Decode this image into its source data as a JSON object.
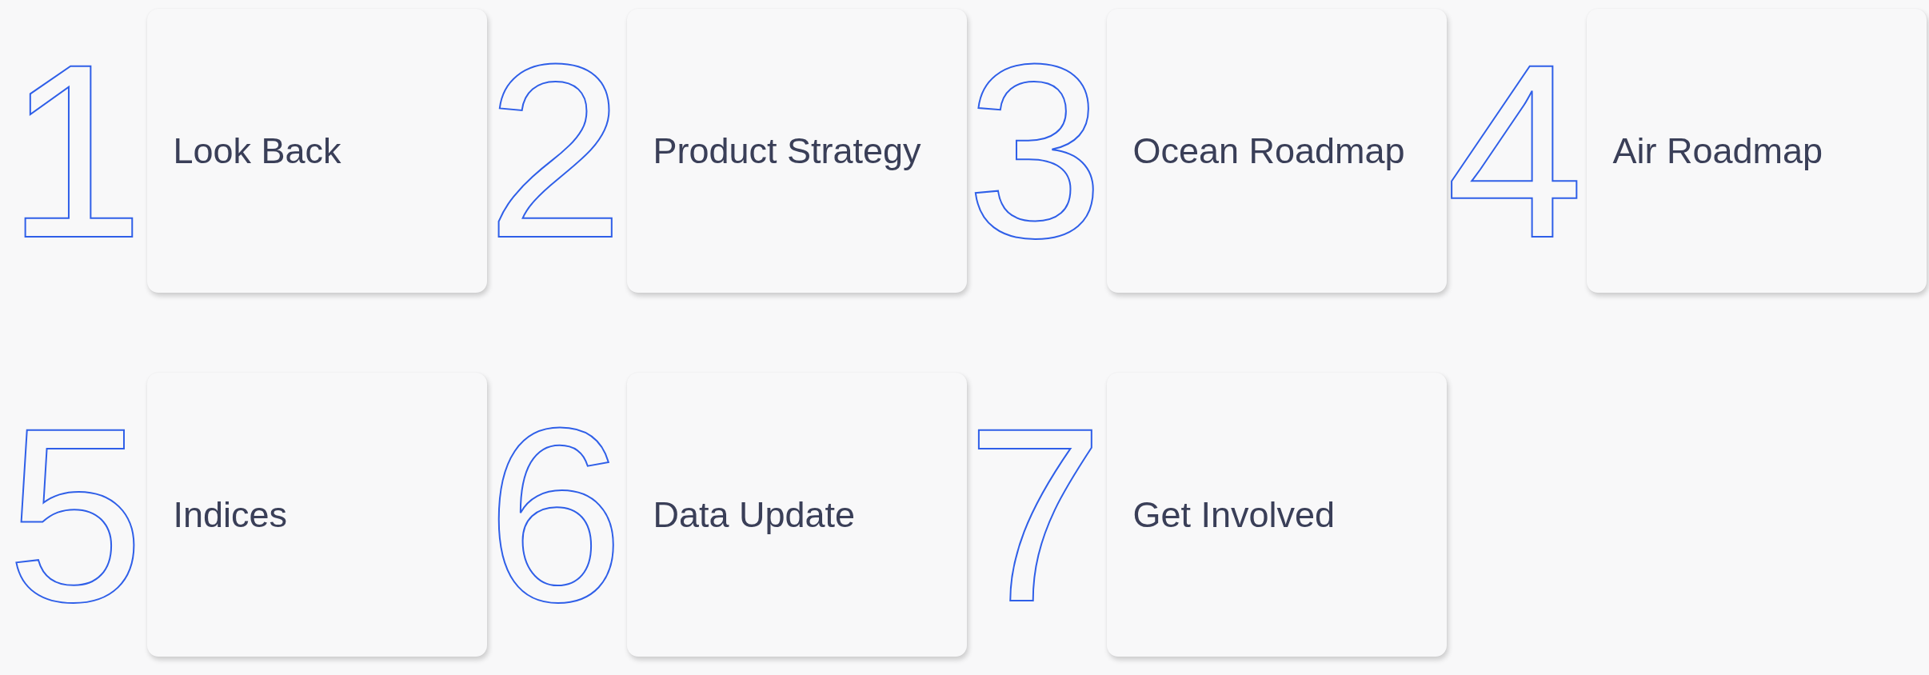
{
  "sections": [
    {
      "number": "1",
      "title": "Look Back"
    },
    {
      "number": "2",
      "title": "Product Strategy"
    },
    {
      "number": "3",
      "title": "Ocean Roadmap"
    },
    {
      "number": "4",
      "title": "Air Roadmap"
    },
    {
      "number": "5",
      "title": "Indices"
    },
    {
      "number": "6",
      "title": "Data Update"
    },
    {
      "number": "7",
      "title": "Get Involved"
    }
  ]
}
